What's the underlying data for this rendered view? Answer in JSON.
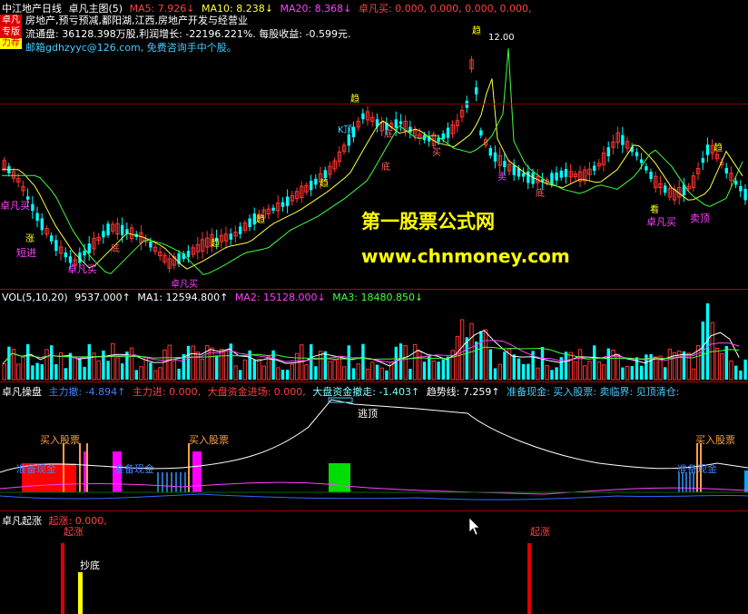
{
  "header": {
    "title": "中江地产日线",
    "indicator": "卓凡主图(5)",
    "ma5": "MA5: 7.926↓",
    "ma10": "MA10: 8.238↓",
    "ma20": "MA20: 8.368↓",
    "buy_signal": "卓凡买: 0.000, 0.000, 0.000, 0.000,",
    "badge_line1": "卓凡",
    "badge_line2": "专版",
    "badge_line3": "力荐"
  },
  "info": {
    "line1": "房地产,预亏预减,鄱阳湖,江西,房地产开发与经营业",
    "line2": "流通盘: 36128.398万股,利润增长: -22196.221%. 每股收益: -0.599元.",
    "line3": "邮箱gdhzyyc@126.com, 免费咨询手中个股。"
  },
  "watermark": {
    "title": "第一股票公式网",
    "url": "www.chnmoney.com"
  },
  "main_chart": {
    "peak_price": "12.00",
    "labels": {
      "zhuo_fan_buy_1": "卓凡买",
      "short_entry": "短进",
      "zhuo_fan_buy_2": "卓凡买",
      "zhuo_fan_buy_3": "卓凡买",
      "zhuo_fan_buy_4": "卓凡买",
      "k_top": "K顶",
      "qu_shi": "趋",
      "di": "底",
      "buy_pos": "买",
      "sell_pos": "卖",
      "nc": "NC",
      "sell_top": "卖顶",
      "kan_zhang": "看",
      "zhang": "涨"
    }
  },
  "volume": {
    "header": "VOL(5,10,20)",
    "vol": "9537.000↑",
    "ma1": "MA1: 12594.800↑",
    "ma2": "MA2: 15128.000↓",
    "ma3": "MA3: 18480.850↓"
  },
  "panel3": {
    "name": "卓凡操盘",
    "main_retreat": "主力撤: -4.894↑",
    "main_enter": "主力进: 0.000,",
    "market_in": "大盘资金进场: 0.000,",
    "market_out": "大盘资金撤走: -1.403↑",
    "trend": "趋势线: 7.259↑",
    "prepare": "准备现金: 买入股票: 卖临界: 见顶清仓:",
    "label_buy_1": "买入股票",
    "label_prepare_1": "准备现金",
    "label_prepare_2": "准备现金",
    "label_buy_2": "买入股票",
    "label_top": "逃顶",
    "label_buy_3": "买入股票",
    "label_prepare_3": "准备现金"
  },
  "panel4": {
    "name": "卓凡起涨",
    "value": "起涨: 0.000,",
    "label_rise_1": "起涨",
    "label_bottom": "抄底",
    "label_rise_2": "起涨"
  },
  "colors": {
    "up": "#ff3333",
    "down": "#00ffff",
    "green": "#00cc00",
    "yellow": "#ffff00",
    "magenta": "#ff00ff",
    "orange": "#ffa040",
    "grid": "#aa0000"
  }
}
